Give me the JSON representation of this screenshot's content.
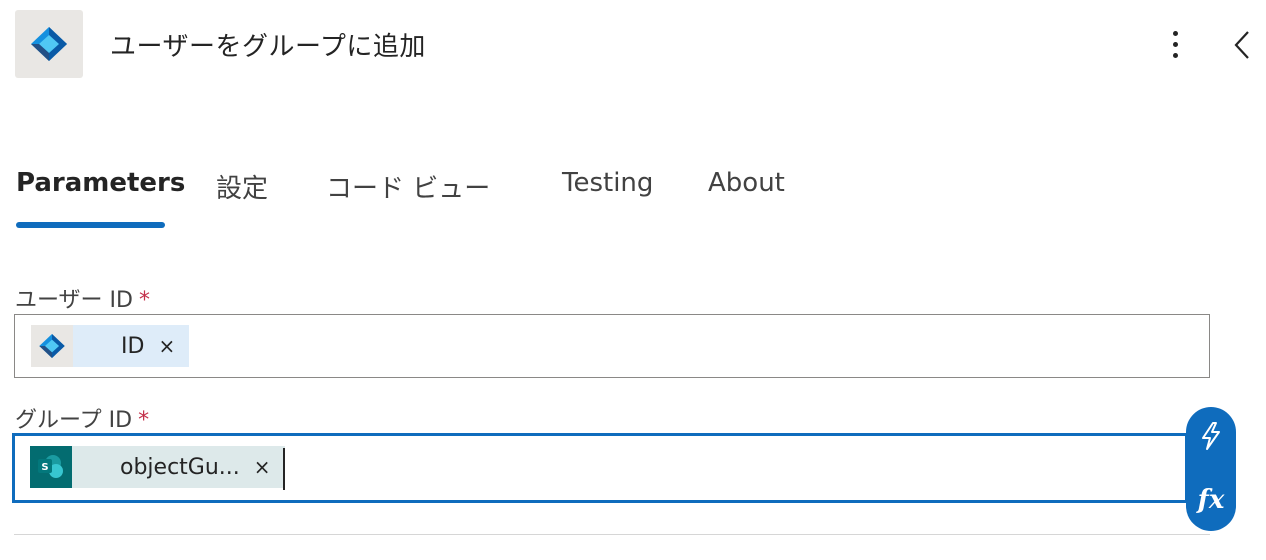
{
  "header": {
    "title": "ユーザーをグループに追加",
    "app_icon": "azure-ad-icon"
  },
  "tabs": [
    {
      "label": "Parameters"
    },
    {
      "label": "設定"
    },
    {
      "label": "コード ビュー"
    },
    {
      "label": "Testing"
    },
    {
      "label": "About"
    }
  ],
  "fields": {
    "user_id": {
      "label": "ユーザー ID",
      "required_mark": "*",
      "token": {
        "label": "ID",
        "remove": "×",
        "icon": "azure-ad-icon"
      }
    },
    "group_id": {
      "label": "グループ ID",
      "required_mark": "*",
      "token": {
        "label": "objectGu...",
        "remove": "×",
        "icon": "sharepoint-icon"
      }
    }
  },
  "side_actions": {
    "dynamic_content_icon": "lightning-icon",
    "expression_label": "fx"
  },
  "colors": {
    "accent": "#0f6cbd",
    "token_bg": "#deecf9",
    "sharepoint_token_bg": "#dde9ea",
    "sharepoint_icon": "#036c70",
    "required": "#c4314b"
  }
}
